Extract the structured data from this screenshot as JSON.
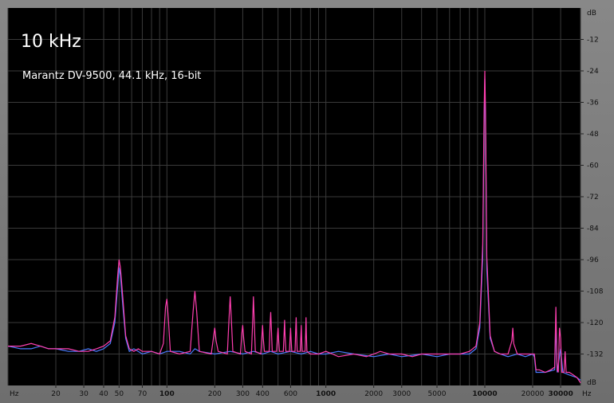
{
  "chart_data": {
    "type": "line",
    "title": "10 kHz",
    "subtitle": "Marantz DV-9500, 44.1 kHz, 16-bit",
    "x_scale": "log",
    "xlim": [
      10,
      40000
    ],
    "ylim": [
      -144,
      0
    ],
    "x_unit_label": "Hz",
    "y_unit_label": "dB",
    "x_ticks": [
      {
        "value": 20,
        "label": "20"
      },
      {
        "value": 30,
        "label": "30"
      },
      {
        "value": 40,
        "label": "40"
      },
      {
        "value": 50,
        "label": "50"
      },
      {
        "value": 70,
        "label": "70"
      },
      {
        "value": 100,
        "label": "100"
      },
      {
        "value": 200,
        "label": "200"
      },
      {
        "value": 300,
        "label": "300"
      },
      {
        "value": 400,
        "label": "400"
      },
      {
        "value": 600,
        "label": "600"
      },
      {
        "value": 1000,
        "label": "1000"
      },
      {
        "value": 2000,
        "label": "2000"
      },
      {
        "value": 3000,
        "label": "3000"
      },
      {
        "value": 5000,
        "label": "5000"
      },
      {
        "value": 10000,
        "label": "10000"
      },
      {
        "value": 20000,
        "label": "20000"
      },
      {
        "value": 30000,
        "label": "30000"
      }
    ],
    "y_ticks": [
      -12,
      -24,
      -36,
      -48,
      -60,
      -72,
      -84,
      -96,
      -108,
      -120,
      -132
    ],
    "grid": true,
    "series": [
      {
        "color": "#ff3fb0",
        "points": [
          [
            10,
            -129
          ],
          [
            12,
            -129
          ],
          [
            14,
            -128
          ],
          [
            16,
            -129
          ],
          [
            18,
            -130
          ],
          [
            20,
            -130
          ],
          [
            24,
            -130
          ],
          [
            28,
            -131
          ],
          [
            32,
            -131
          ],
          [
            36,
            -130
          ],
          [
            40,
            -129
          ],
          [
            44,
            -127
          ],
          [
            47,
            -118
          ],
          [
            49,
            -102
          ],
          [
            50,
            -96
          ],
          [
            51,
            -99
          ],
          [
            53,
            -112
          ],
          [
            55,
            -125
          ],
          [
            58,
            -130
          ],
          [
            62,
            -131
          ],
          [
            66,
            -130
          ],
          [
            70,
            -131
          ],
          [
            80,
            -131
          ],
          [
            90,
            -132
          ],
          [
            95,
            -128
          ],
          [
            98,
            -114
          ],
          [
            100,
            -111
          ],
          [
            102,
            -118
          ],
          [
            105,
            -131
          ],
          [
            120,
            -132
          ],
          [
            140,
            -131
          ],
          [
            146,
            -116
          ],
          [
            150,
            -108
          ],
          [
            154,
            -116
          ],
          [
            160,
            -131
          ],
          [
            190,
            -132
          ],
          [
            196,
            -126
          ],
          [
            200,
            -122
          ],
          [
            204,
            -127
          ],
          [
            210,
            -131
          ],
          [
            240,
            -132
          ],
          [
            246,
            -118
          ],
          [
            250,
            -110
          ],
          [
            254,
            -118
          ],
          [
            260,
            -131
          ],
          [
            290,
            -132
          ],
          [
            296,
            -124
          ],
          [
            300,
            -121
          ],
          [
            304,
            -126
          ],
          [
            310,
            -131
          ],
          [
            340,
            -132
          ],
          [
            346,
            -120
          ],
          [
            350,
            -110
          ],
          [
            354,
            -119
          ],
          [
            360,
            -131
          ],
          [
            390,
            -132
          ],
          [
            396,
            -125
          ],
          [
            400,
            -121
          ],
          [
            404,
            -126
          ],
          [
            410,
            -131
          ],
          [
            440,
            -131
          ],
          [
            446,
            -120
          ],
          [
            450,
            -116
          ],
          [
            454,
            -122
          ],
          [
            460,
            -131
          ],
          [
            490,
            -131
          ],
          [
            496,
            -125
          ],
          [
            500,
            -122
          ],
          [
            504,
            -126
          ],
          [
            510,
            -131
          ],
          [
            540,
            -131
          ],
          [
            546,
            -124
          ],
          [
            550,
            -119
          ],
          [
            554,
            -125
          ],
          [
            560,
            -131
          ],
          [
            590,
            -131
          ],
          [
            596,
            -125
          ],
          [
            600,
            -122
          ],
          [
            604,
            -126
          ],
          [
            610,
            -131
          ],
          [
            640,
            -131
          ],
          [
            646,
            -123
          ],
          [
            650,
            -118
          ],
          [
            654,
            -124
          ],
          [
            660,
            -131
          ],
          [
            690,
            -131
          ],
          [
            696,
            -125
          ],
          [
            700,
            -121
          ],
          [
            704,
            -126
          ],
          [
            710,
            -131
          ],
          [
            740,
            -131
          ],
          [
            746,
            -124
          ],
          [
            750,
            -118
          ],
          [
            754,
            -124
          ],
          [
            760,
            -131
          ],
          [
            800,
            -132
          ],
          [
            900,
            -132
          ],
          [
            1000,
            -131
          ],
          [
            1100,
            -132
          ],
          [
            1200,
            -133
          ],
          [
            1500,
            -132
          ],
          [
            1800,
            -133
          ],
          [
            2000,
            -132
          ],
          [
            2200,
            -131
          ],
          [
            2500,
            -132
          ],
          [
            3000,
            -132
          ],
          [
            3500,
            -133
          ],
          [
            4000,
            -132
          ],
          [
            5000,
            -132
          ],
          [
            6000,
            -132
          ],
          [
            7000,
            -132
          ],
          [
            8000,
            -131
          ],
          [
            8800,
            -129
          ],
          [
            9300,
            -120
          ],
          [
            9700,
            -90
          ],
          [
            9900,
            -40
          ],
          [
            10000,
            -24
          ],
          [
            10100,
            -40
          ],
          [
            10300,
            -95
          ],
          [
            10800,
            -125
          ],
          [
            11500,
            -131
          ],
          [
            12500,
            -132
          ],
          [
            14000,
            -132
          ],
          [
            14800,
            -127
          ],
          [
            15000,
            -122
          ],
          [
            15200,
            -128
          ],
          [
            16000,
            -132
          ],
          [
            18000,
            -132
          ],
          [
            20000,
            -132
          ],
          [
            20500,
            -132
          ],
          [
            21000,
            -138
          ],
          [
            22000,
            -138
          ],
          [
            24000,
            -139
          ],
          [
            26000,
            -138
          ],
          [
            27500,
            -137
          ],
          [
            28000,
            -114
          ],
          [
            28500,
            -138
          ],
          [
            29000,
            -139
          ],
          [
            29500,
            -122
          ],
          [
            30000,
            -126
          ],
          [
            30500,
            -139
          ],
          [
            31500,
            -139
          ],
          [
            32000,
            -131
          ],
          [
            32500,
            -139
          ],
          [
            34000,
            -139
          ],
          [
            36000,
            -140
          ],
          [
            38000,
            -141
          ],
          [
            40000,
            -143
          ]
        ]
      },
      {
        "color": "#4a7cff",
        "points": [
          [
            10,
            -129
          ],
          [
            12,
            -130
          ],
          [
            14,
            -130
          ],
          [
            16,
            -129
          ],
          [
            18,
            -130
          ],
          [
            20,
            -130
          ],
          [
            24,
            -131
          ],
          [
            28,
            -131
          ],
          [
            32,
            -130
          ],
          [
            36,
            -131
          ],
          [
            40,
            -130
          ],
          [
            44,
            -128
          ],
          [
            47,
            -120
          ],
          [
            49,
            -106
          ],
          [
            50,
            -99
          ],
          [
            51,
            -102
          ],
          [
            53,
            -115
          ],
          [
            55,
            -126
          ],
          [
            58,
            -131
          ],
          [
            62,
            -130
          ],
          [
            66,
            -131
          ],
          [
            70,
            -132
          ],
          [
            80,
            -131
          ],
          [
            90,
            -132
          ],
          [
            100,
            -131
          ],
          [
            120,
            -131
          ],
          [
            140,
            -132
          ],
          [
            150,
            -130
          ],
          [
            160,
            -131
          ],
          [
            200,
            -132
          ],
          [
            250,
            -131
          ],
          [
            300,
            -132
          ],
          [
            350,
            -131
          ],
          [
            400,
            -132
          ],
          [
            450,
            -131
          ],
          [
            500,
            -132
          ],
          [
            600,
            -131
          ],
          [
            700,
            -132
          ],
          [
            800,
            -131
          ],
          [
            900,
            -132
          ],
          [
            1000,
            -132
          ],
          [
            1200,
            -131
          ],
          [
            1500,
            -132
          ],
          [
            2000,
            -133
          ],
          [
            2500,
            -132
          ],
          [
            3000,
            -133
          ],
          [
            4000,
            -132
          ],
          [
            5000,
            -133
          ],
          [
            6000,
            -132
          ],
          [
            7000,
            -132
          ],
          [
            8000,
            -132
          ],
          [
            8800,
            -130
          ],
          [
            9300,
            -122
          ],
          [
            9700,
            -95
          ],
          [
            9900,
            -45
          ],
          [
            10000,
            -27
          ],
          [
            10100,
            -45
          ],
          [
            10300,
            -100
          ],
          [
            10800,
            -126
          ],
          [
            11500,
            -131
          ],
          [
            12500,
            -132
          ],
          [
            14000,
            -133
          ],
          [
            16000,
            -132
          ],
          [
            18000,
            -133
          ],
          [
            20000,
            -132
          ],
          [
            20500,
            -133
          ],
          [
            21000,
            -139
          ],
          [
            24000,
            -139
          ],
          [
            27500,
            -138
          ],
          [
            28000,
            -120
          ],
          [
            28500,
            -139
          ],
          [
            30000,
            -130
          ],
          [
            31000,
            -139
          ],
          [
            34000,
            -140
          ],
          [
            38000,
            -141
          ],
          [
            40000,
            -142
          ]
        ]
      }
    ]
  }
}
